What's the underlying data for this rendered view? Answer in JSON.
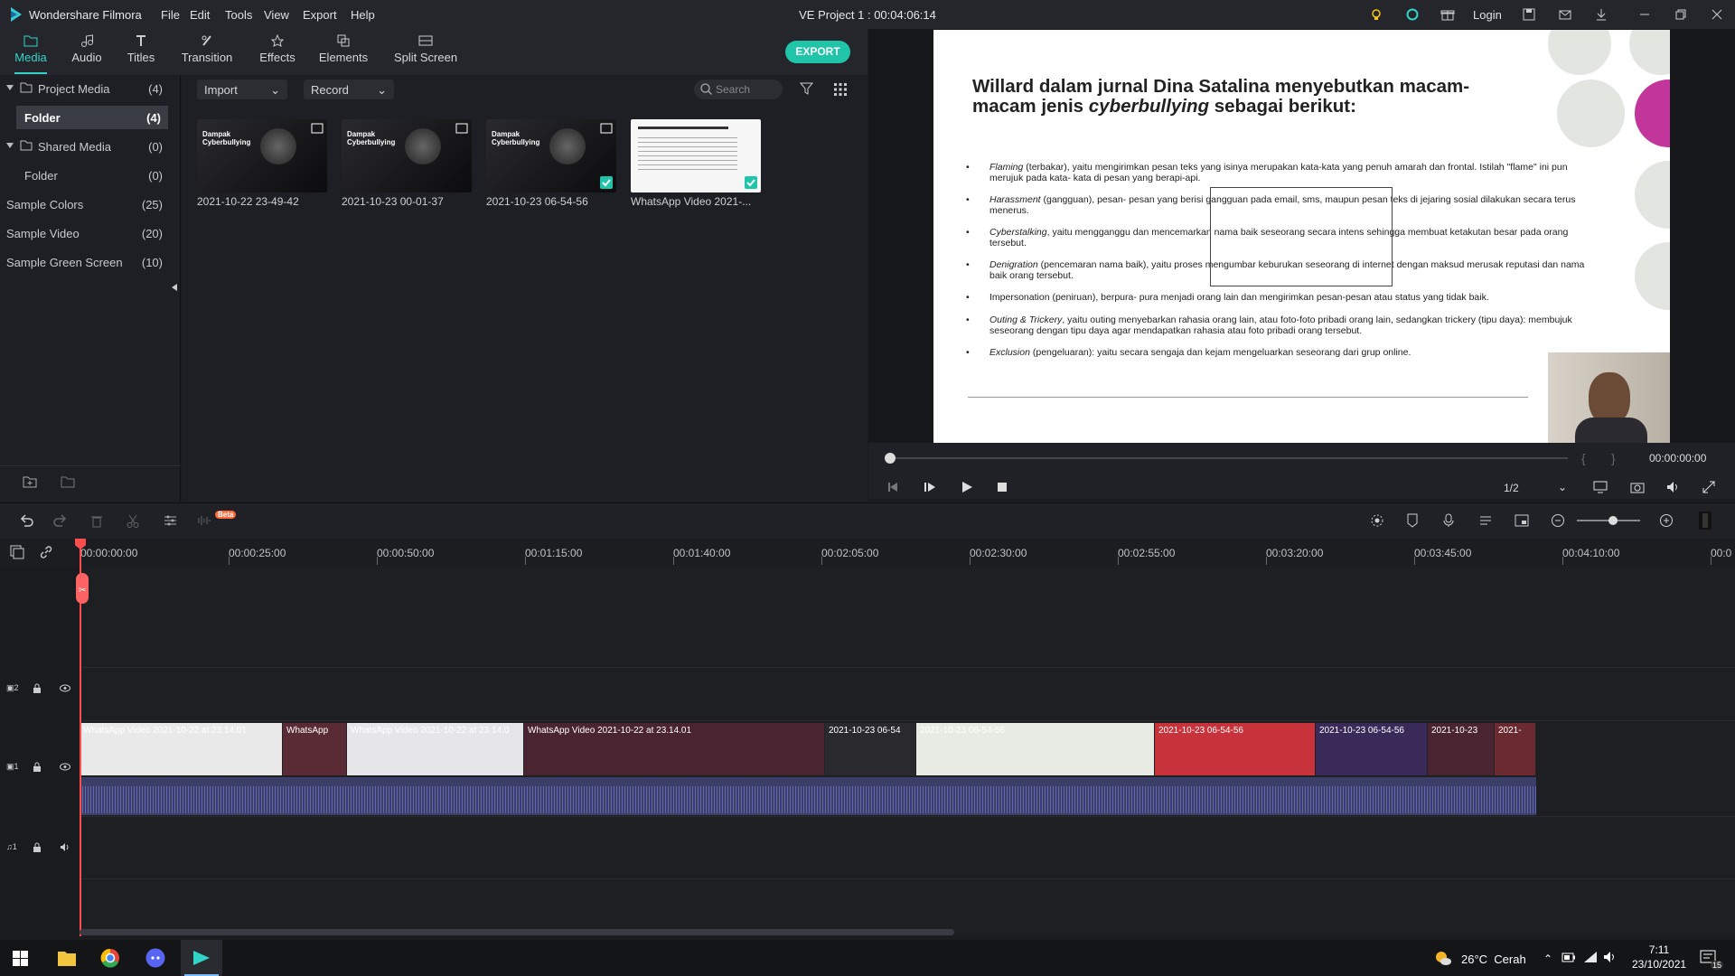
{
  "app": {
    "name": "Wondershare Filmora",
    "project_title": "VE Project 1 : 00:04:06:14",
    "login_label": "Login"
  },
  "menu": [
    "File",
    "Edit",
    "Tools",
    "View",
    "Export",
    "Help"
  ],
  "tabs": [
    {
      "label": "Media",
      "icon": "folder-icon",
      "active": true
    },
    {
      "label": "Audio",
      "icon": "music-note-icon"
    },
    {
      "label": "Titles",
      "icon": "text-icon"
    },
    {
      "label": "Transition",
      "icon": "transition-icon"
    },
    {
      "label": "Effects",
      "icon": "effects-icon"
    },
    {
      "label": "Elements",
      "icon": "elements-icon"
    },
    {
      "label": "Split Screen",
      "icon": "split-screen-icon"
    }
  ],
  "export_label": "EXPORT",
  "sidebar": [
    {
      "label": "Project Media",
      "count": "(4)"
    },
    {
      "label": "Folder",
      "count": "(4)"
    },
    {
      "label": "Shared Media",
      "count": "(0)"
    },
    {
      "label": "Folder",
      "count": "(0)"
    },
    {
      "label": "Sample Colors",
      "count": "(25)"
    },
    {
      "label": "Sample Video",
      "count": "(20)"
    },
    {
      "label": "Sample Green Screen",
      "count": "(10)"
    }
  ],
  "media_toolbar": {
    "import_label": "Import",
    "record_label": "Record",
    "search_placeholder": "Search"
  },
  "media_items": [
    {
      "label": "2021-10-22 23-49-42",
      "thumb_text": "Dampak Cyberbullying",
      "checked": false
    },
    {
      "label": "2021-10-23 00-01-37",
      "thumb_text": "Dampak Cyberbullying",
      "checked": false
    },
    {
      "label": "2021-10-23 06-54-56",
      "thumb_text": "Dampak Cyberbullying",
      "checked": true
    },
    {
      "label": "WhatsApp Video 2021-...",
      "thumb_text": "",
      "checked": true
    }
  ],
  "slide": {
    "heading_line1": "Willard dalam jurnal Dina Satalina menyebutkan macam-",
    "heading_line2_pre": "macam jenis ",
    "heading_line2_em": "cyberbullying",
    "heading_line2_post": " sebagai berikut:",
    "bullets": [
      {
        "term": "Flaming",
        "text": " (terbakar), yaitu mengirimkan pesan teks yang isinya merupakan kata-kata yang penuh amarah dan frontal. Istilah \"flame\" ini pun merujuk pada kata- kata di pesan yang berapi-api."
      },
      {
        "term": "Harassment",
        "text": " (gangguan), pesan- pesan yang berisi gangguan pada email, sms, maupun pesan teks di jejaring sosial dilakukan secara terus menerus."
      },
      {
        "term": "Cyberstalking",
        "text": ", yaitu mengganggu dan mencemarkan nama baik seseorang secara intens sehingga membuat ketakutan besar pada orang tersebut."
      },
      {
        "term": "Denigration",
        "text": " (pencemaran nama baik), yaitu proses mengumbar keburukan seseorang di internet dengan maksud merusak reputasi dan nama baik orang tersebut."
      },
      {
        "term": "",
        "text": "Impersonation (peniruan), berpura- pura menjadi orang lain dan mengirimkan pesan-pesan atau status yang tidak baik."
      },
      {
        "term": "Outing & Trickery",
        "text": ", yaitu outing menyebarkan rahasia orang lain, atau foto-foto pribadi orang lain, sedangkan trickery (tipu daya): membujuk seseorang dengan tipu daya agar mendapatkan rahasia atau foto pribadi orang tersebut."
      },
      {
        "term": "Exclusion",
        "text": " (pengeluaran): yaitu secara sengaja dan kejam mengeluarkan seseorang dari grup online."
      }
    ]
  },
  "player": {
    "timecode": "00:00:00:00",
    "quality": "1/2",
    "progress": 0
  },
  "ruler_labels": [
    "00:00:00:00",
    "00:00:25:00",
    "00:00:50:00",
    "00:01:15:00",
    "00:01:40:00",
    "00:02:05:00",
    "00:02:30:00",
    "00:02:55:00",
    "00:03:20:00",
    "00:03:45:00",
    "00:04:10:00",
    "00:0"
  ],
  "beta_label": "Beta",
  "tracks": {
    "v2": "2",
    "v1": "1",
    "a1": "1"
  },
  "clips": [
    {
      "name": "WhatsApp Video 2021-10-22 at 23.14.01",
      "color": "#e9e9ea"
    },
    {
      "name": "WhatsApp",
      "color": "#5b2b35"
    },
    {
      "name": "WhatsApp Video 2021-10-22 at 23.14.0",
      "color": "#e6e6e8"
    },
    {
      "name": "WhatsApp Video 2021-10-22 at 23.14.01",
      "color": "#4a2430"
    },
    {
      "name": "2021-10-23 06-54",
      "color": "#2a2a2e"
    },
    {
      "name": "2021-10-23 06-54-56",
      "color": "#e8ebe4"
    },
    {
      "name": "2021-10-23 06-54-56",
      "color": "#c8323a"
    },
    {
      "name": "2021-10-23 06-54-56",
      "color": "#3a2a5a"
    },
    {
      "name": "2021-10-23",
      "color": "#4a2430"
    },
    {
      "name": "2021-",
      "color": "#6a2a30"
    }
  ],
  "taskbar": {
    "weather": "26°C  Cerah",
    "time": "7:11",
    "date": "23/10/2021",
    "notif_count": "15"
  },
  "colors": {
    "accent": "#30d5c8",
    "export": "#20c5a9",
    "playhead": "#ff4d4d"
  }
}
